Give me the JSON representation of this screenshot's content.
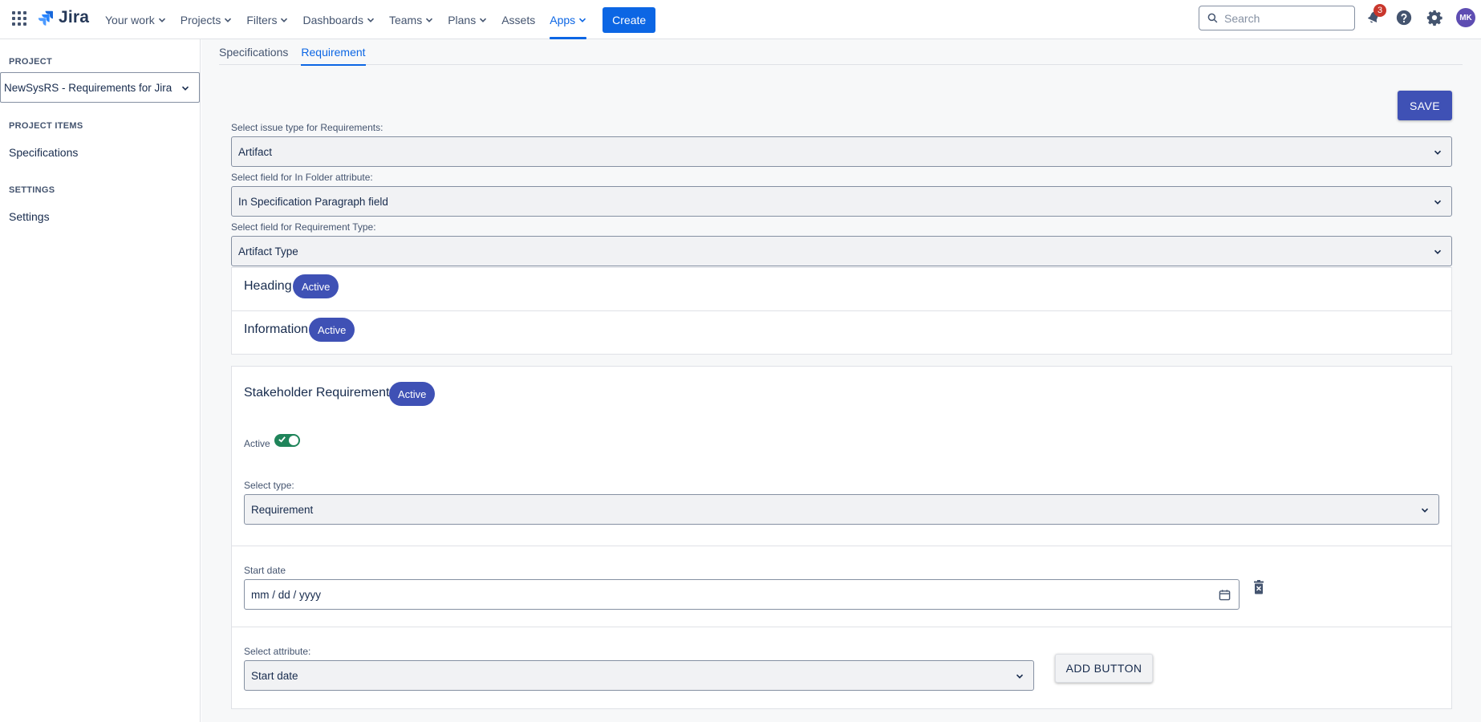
{
  "nav": {
    "logo": "Jira",
    "items": [
      {
        "label": "Your work",
        "dropdown": true,
        "active": false
      },
      {
        "label": "Projects",
        "dropdown": true,
        "active": false
      },
      {
        "label": "Filters",
        "dropdown": true,
        "active": false
      },
      {
        "label": "Dashboards",
        "dropdown": true,
        "active": false
      },
      {
        "label": "Teams",
        "dropdown": true,
        "active": false
      },
      {
        "label": "Plans",
        "dropdown": true,
        "active": false
      },
      {
        "label": "Assets",
        "dropdown": false,
        "active": false
      },
      {
        "label": "Apps",
        "dropdown": true,
        "active": true
      }
    ],
    "create_label": "Create",
    "search_placeholder": "Search",
    "notification_count": "3",
    "avatar_initials": "MK"
  },
  "sidebar": {
    "project_heading": "PROJECT",
    "project_selected": "NewSysRS - Requirements for Jira",
    "items_heading": "PROJECT ITEMS",
    "specifications_label": "Specifications",
    "settings_heading": "SETTINGS",
    "settings_label": "Settings"
  },
  "tabs": [
    {
      "label": "Specifications",
      "active": false
    },
    {
      "label": "Requirement",
      "active": true
    }
  ],
  "form": {
    "save_label": "SAVE",
    "issue_type_label": "Select issue type for Requirements:",
    "issue_type_value": "Artifact",
    "folder_field_label": "Select field for In Folder attribute:",
    "folder_field_value": "In Specification Paragraph field",
    "req_type_label": "Select field for Requirement Type:",
    "req_type_value": "Artifact Type"
  },
  "types": {
    "heading": {
      "title": "Heading",
      "status": "Active"
    },
    "information": {
      "title": "Information",
      "status": "Active"
    },
    "stakeholder": {
      "title": "Stakeholder Requirement",
      "status": "Active",
      "active_label": "Active",
      "active_on": true,
      "select_type_label": "Select type:",
      "select_type_value": "Requirement",
      "start_date_label": "Start date",
      "start_date_placeholder": "mm / dd / yyyy",
      "attribute_label": "Select attribute:",
      "attribute_value": "Start date",
      "add_button_label": "ADD BUTTON"
    }
  },
  "colors": {
    "brand": "#0c66e4",
    "badge": "#3f51b5",
    "toggle_on": "#1f845a",
    "notification": "#c9372c"
  }
}
